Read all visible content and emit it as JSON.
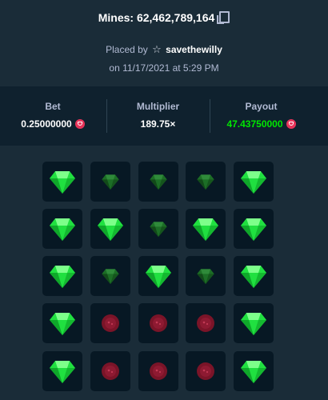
{
  "header": {
    "title": "Mines: 62,462,789,164",
    "placed_by_prefix": "Placed by",
    "username": "savethewilly",
    "date": "on 11/17/2021 at 5:29 PM"
  },
  "stats": {
    "bet_label": "Bet",
    "bet_value": "0.25000000",
    "multiplier_label": "Multiplier",
    "multiplier_value": "189.75×",
    "payout_label": "Payout",
    "payout_value": "47.43750000"
  },
  "colors": {
    "background": "#1a2c38",
    "panel": "#0f212e",
    "tile": "#071824",
    "payout_green": "#00e701",
    "gem_bright": "#20e040",
    "gem_dim": "#1c6e26",
    "mine": "#7a1428",
    "coin": "#e8345a"
  },
  "board": {
    "rows": [
      [
        "gem-revealed",
        "gem-unrevealed",
        "gem-unrevealed",
        "gem-unrevealed",
        "gem-revealed"
      ],
      [
        "gem-revealed",
        "gem-revealed",
        "gem-unrevealed",
        "gem-revealed",
        "gem-revealed"
      ],
      [
        "gem-revealed",
        "gem-unrevealed",
        "gem-revealed",
        "gem-unrevealed",
        "gem-revealed"
      ],
      [
        "gem-revealed",
        "mine",
        "mine",
        "mine",
        "gem-revealed"
      ],
      [
        "gem-revealed",
        "mine",
        "mine",
        "mine",
        "gem-revealed"
      ]
    ]
  }
}
